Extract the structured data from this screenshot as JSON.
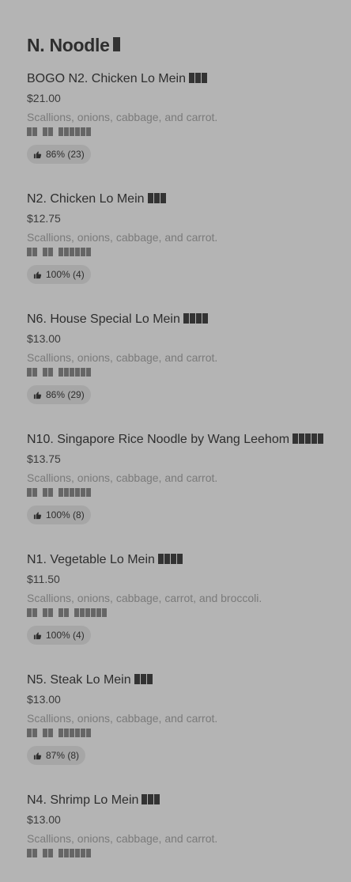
{
  "section": {
    "title": "N. Noodle"
  },
  "items": [
    {
      "name": "BOGO N2. Chicken Lo Mein",
      "cjk": 3,
      "price": "$21.00",
      "description": "Scallions, onions, cabbage, and carrot.",
      "desc_groups": [
        2,
        2,
        6
      ],
      "rating": "86% (23)"
    },
    {
      "name": "N2. Chicken Lo Mein",
      "cjk": 3,
      "price": "$12.75",
      "description": "Scallions, onions, cabbage, and carrot.",
      "desc_groups": [
        2,
        2,
        6
      ],
      "rating": "100% (4)"
    },
    {
      "name": "N6. House Special Lo Mein",
      "cjk": 4,
      "price": "$13.00",
      "description": "Scallions, onions, cabbage, and carrot.",
      "desc_groups": [
        2,
        2,
        6
      ],
      "rating": "86% (29)"
    },
    {
      "name": "N10. Singapore Rice Noodle by Wang Leehom",
      "cjk": 5,
      "price": "$13.75",
      "description": "Scallions, onions, cabbage, and carrot.",
      "desc_groups": [
        2,
        2,
        6
      ],
      "rating": "100% (8)"
    },
    {
      "name": "N1. Vegetable Lo Mein",
      "cjk": 4,
      "price": "$11.50",
      "description": "Scallions, onions, cabbage, carrot, and broccoli.",
      "desc_groups": [
        2,
        2,
        2,
        6
      ],
      "rating": "100% (4)"
    },
    {
      "name": "N5. Steak Lo Mein",
      "cjk": 3,
      "price": "$13.00",
      "description": "Scallions, onions, cabbage, and carrot.",
      "desc_groups": [
        2,
        2,
        6
      ],
      "rating": "87% (8)"
    },
    {
      "name": "N4. Shrimp Lo Mein",
      "cjk": 3,
      "price": "$13.00",
      "description": "Scallions, onions, cabbage, and carrot.",
      "desc_groups": [
        2,
        2,
        6
      ],
      "rating": null
    }
  ],
  "icons": {
    "rating": "thumbs-up-icon"
  }
}
